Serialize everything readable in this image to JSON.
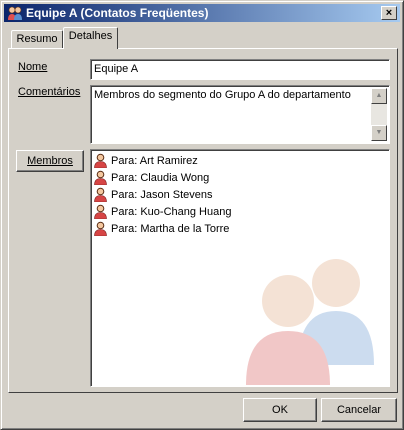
{
  "window": {
    "title": "Equipe A (Contatos Freqüentes)",
    "title_icon": "group-contacts-icon",
    "close_symbol": "×"
  },
  "tabs": [
    {
      "label": "Resumo",
      "active": false
    },
    {
      "label": "Detalhes",
      "active": true
    }
  ],
  "form": {
    "name_label": "Nome",
    "name_value": "Equipe A",
    "comments_label": "Comentários",
    "comments_value": "Membros do segmento do Grupo A do departamento",
    "members_button": "Membros"
  },
  "members": [
    {
      "text": "Para: Art Ramirez",
      "icon": "person-icon"
    },
    {
      "text": "Para: Claudia Wong",
      "icon": "person-icon"
    },
    {
      "text": "Para: Jason Stevens",
      "icon": "person-icon"
    },
    {
      "text": "Para: Kuo-Chang Huang",
      "icon": "person-icon"
    },
    {
      "text": "Para: Martha de la Torre",
      "icon": "person-icon"
    }
  ],
  "footer": {
    "ok_label": "OK",
    "cancel_label": "Cancelar"
  },
  "colors": {
    "title_start": "#0a246a",
    "title_end": "#a6caf0",
    "face": "#d4d0c8"
  }
}
